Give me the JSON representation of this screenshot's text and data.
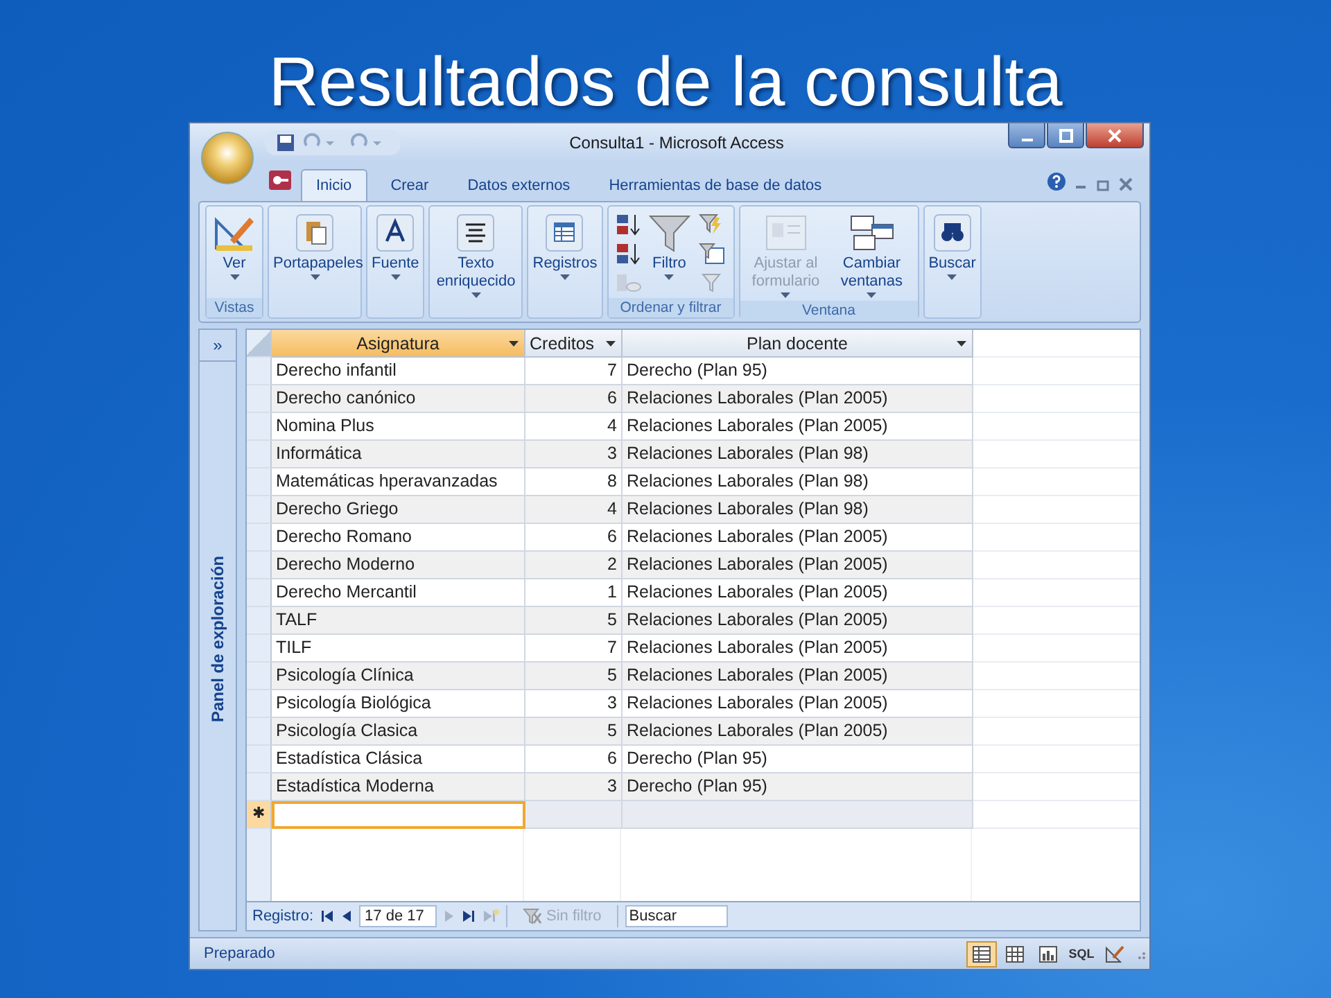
{
  "slide_title": "Resultados de la consulta",
  "window": {
    "title": "Consulta1 - Microsoft Access"
  },
  "tabs": [
    {
      "label": "Inicio",
      "selected": true
    },
    {
      "label": "Crear",
      "selected": false
    },
    {
      "label": "Datos externos",
      "selected": false
    },
    {
      "label": "Herramientas de base de datos",
      "selected": false
    }
  ],
  "ribbon": {
    "groups": [
      {
        "label": "Vistas",
        "buttons": [
          {
            "label": "Ver",
            "disabled": false
          }
        ]
      },
      {
        "buttons": [
          {
            "label": "Portapapeles",
            "disabled": false
          }
        ]
      },
      {
        "buttons": [
          {
            "label": "Fuente",
            "disabled": false
          }
        ]
      },
      {
        "buttons": [
          {
            "label": "Texto enriquecido",
            "disabled": false
          }
        ]
      },
      {
        "buttons": [
          {
            "label": "Registros",
            "disabled": false
          }
        ]
      },
      {
        "label": "Ordenar y filtrar",
        "buttons": [
          {
            "label": "Filtro",
            "disabled": false
          }
        ]
      },
      {
        "label": "Ventana",
        "buttons": [
          {
            "label": "Ajustar al formulario",
            "disabled": true
          },
          {
            "label": "Cambiar ventanas",
            "disabled": false
          }
        ]
      },
      {
        "buttons": [
          {
            "label": "Buscar",
            "disabled": false
          }
        ]
      }
    ]
  },
  "nav_pane": {
    "toggle": "»",
    "label": "Panel de exploración"
  },
  "table": {
    "columns": [
      {
        "label": "Asignatura",
        "selected": true
      },
      {
        "label": "Creditos",
        "selected": false
      },
      {
        "label": "Plan docente",
        "selected": false
      }
    ],
    "rows": [
      [
        "Derecho infantil",
        "7",
        "Derecho (Plan 95)"
      ],
      [
        "Derecho canónico",
        "6",
        "Relaciones Laborales (Plan 2005)"
      ],
      [
        "Nomina Plus",
        "4",
        "Relaciones Laborales (Plan 2005)"
      ],
      [
        "Informática",
        "3",
        "Relaciones Laborales (Plan 98)"
      ],
      [
        "Matemáticas hperavanzadas",
        "8",
        "Relaciones Laborales (Plan 98)"
      ],
      [
        "Derecho Griego",
        "4",
        "Relaciones Laborales (Plan 98)"
      ],
      [
        "Derecho Romano",
        "6",
        "Relaciones Laborales (Plan 2005)"
      ],
      [
        "Derecho Moderno",
        "2",
        "Relaciones Laborales (Plan 2005)"
      ],
      [
        "Derecho Mercantil",
        "1",
        "Relaciones Laborales (Plan 2005)"
      ],
      [
        "TALF",
        "5",
        "Relaciones Laborales (Plan 2005)"
      ],
      [
        "TILF",
        "7",
        "Relaciones Laborales (Plan 2005)"
      ],
      [
        "Psicología Clínica",
        "5",
        "Relaciones Laborales (Plan 2005)"
      ],
      [
        "Psicología Biológica",
        "3",
        "Relaciones Laborales (Plan 2005)"
      ],
      [
        "Psicología Clasica",
        "5",
        "Relaciones Laborales (Plan 2005)"
      ],
      [
        "Estadística Clásica",
        "6",
        "Derecho (Plan 95)"
      ],
      [
        "Estadística Moderna",
        "3",
        "Derecho (Plan 95)"
      ]
    ],
    "new_row_marker": "✱"
  },
  "record_nav": {
    "label": "Registro:",
    "position": "17 de 17",
    "filter": "Sin filtro",
    "filter_disabled": true,
    "search_placeholder": "Buscar"
  },
  "status_bar": {
    "text": "Preparado",
    "views": [
      {
        "selected": true
      },
      {
        "selected": false
      },
      {
        "selected": false
      },
      {
        "label": "SQL",
        "selected": false
      },
      {
        "selected": false
      }
    ]
  }
}
